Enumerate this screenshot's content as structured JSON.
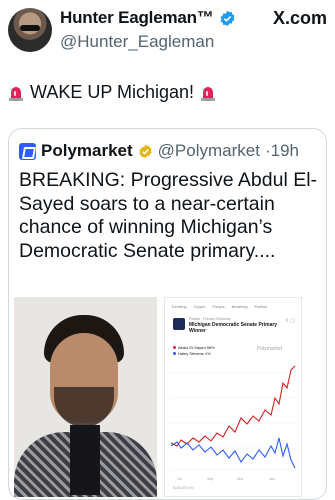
{
  "author": {
    "name": "Hunter Eagleman™",
    "handle": "@Hunter_Eagleman",
    "verified_icon": "blue-verified-badge-icon",
    "watermark": "X.com"
  },
  "tweet": {
    "text": "WAKE UP Michigan!",
    "emoji": "police-siren-icon"
  },
  "quoted": {
    "name": "Polymarket",
    "handle": "@Polymarket",
    "time": "·19h",
    "verified_icon": "gold-verified-badge-icon",
    "body": "BREAKING: Progressive Abdul El-Sayed soars to a near-certain chance of winning Michigan’s Democratic Senate primary....",
    "media": {
      "photo": "portrait-photo",
      "screenshot": {
        "nav": [
          "Trending",
          "Crypto",
          "Pinops",
          "Breaking",
          "Politics"
        ],
        "category": "Politics · Primary Elections",
        "title": "Michigan Democratic Senate Primary Winner",
        "legend": [
          {
            "label": "Abdul El-Sayed 98%",
            "color": "#e0245e"
          },
          {
            "label": "Haley Stevens 1%",
            "color": "#2e5cff"
          }
        ],
        "watermark": "Polymarket",
        "volume": "$135,875 Vol",
        "colors": {
          "series_a": "#d62020",
          "series_b": "#2e5cff"
        }
      }
    }
  }
}
